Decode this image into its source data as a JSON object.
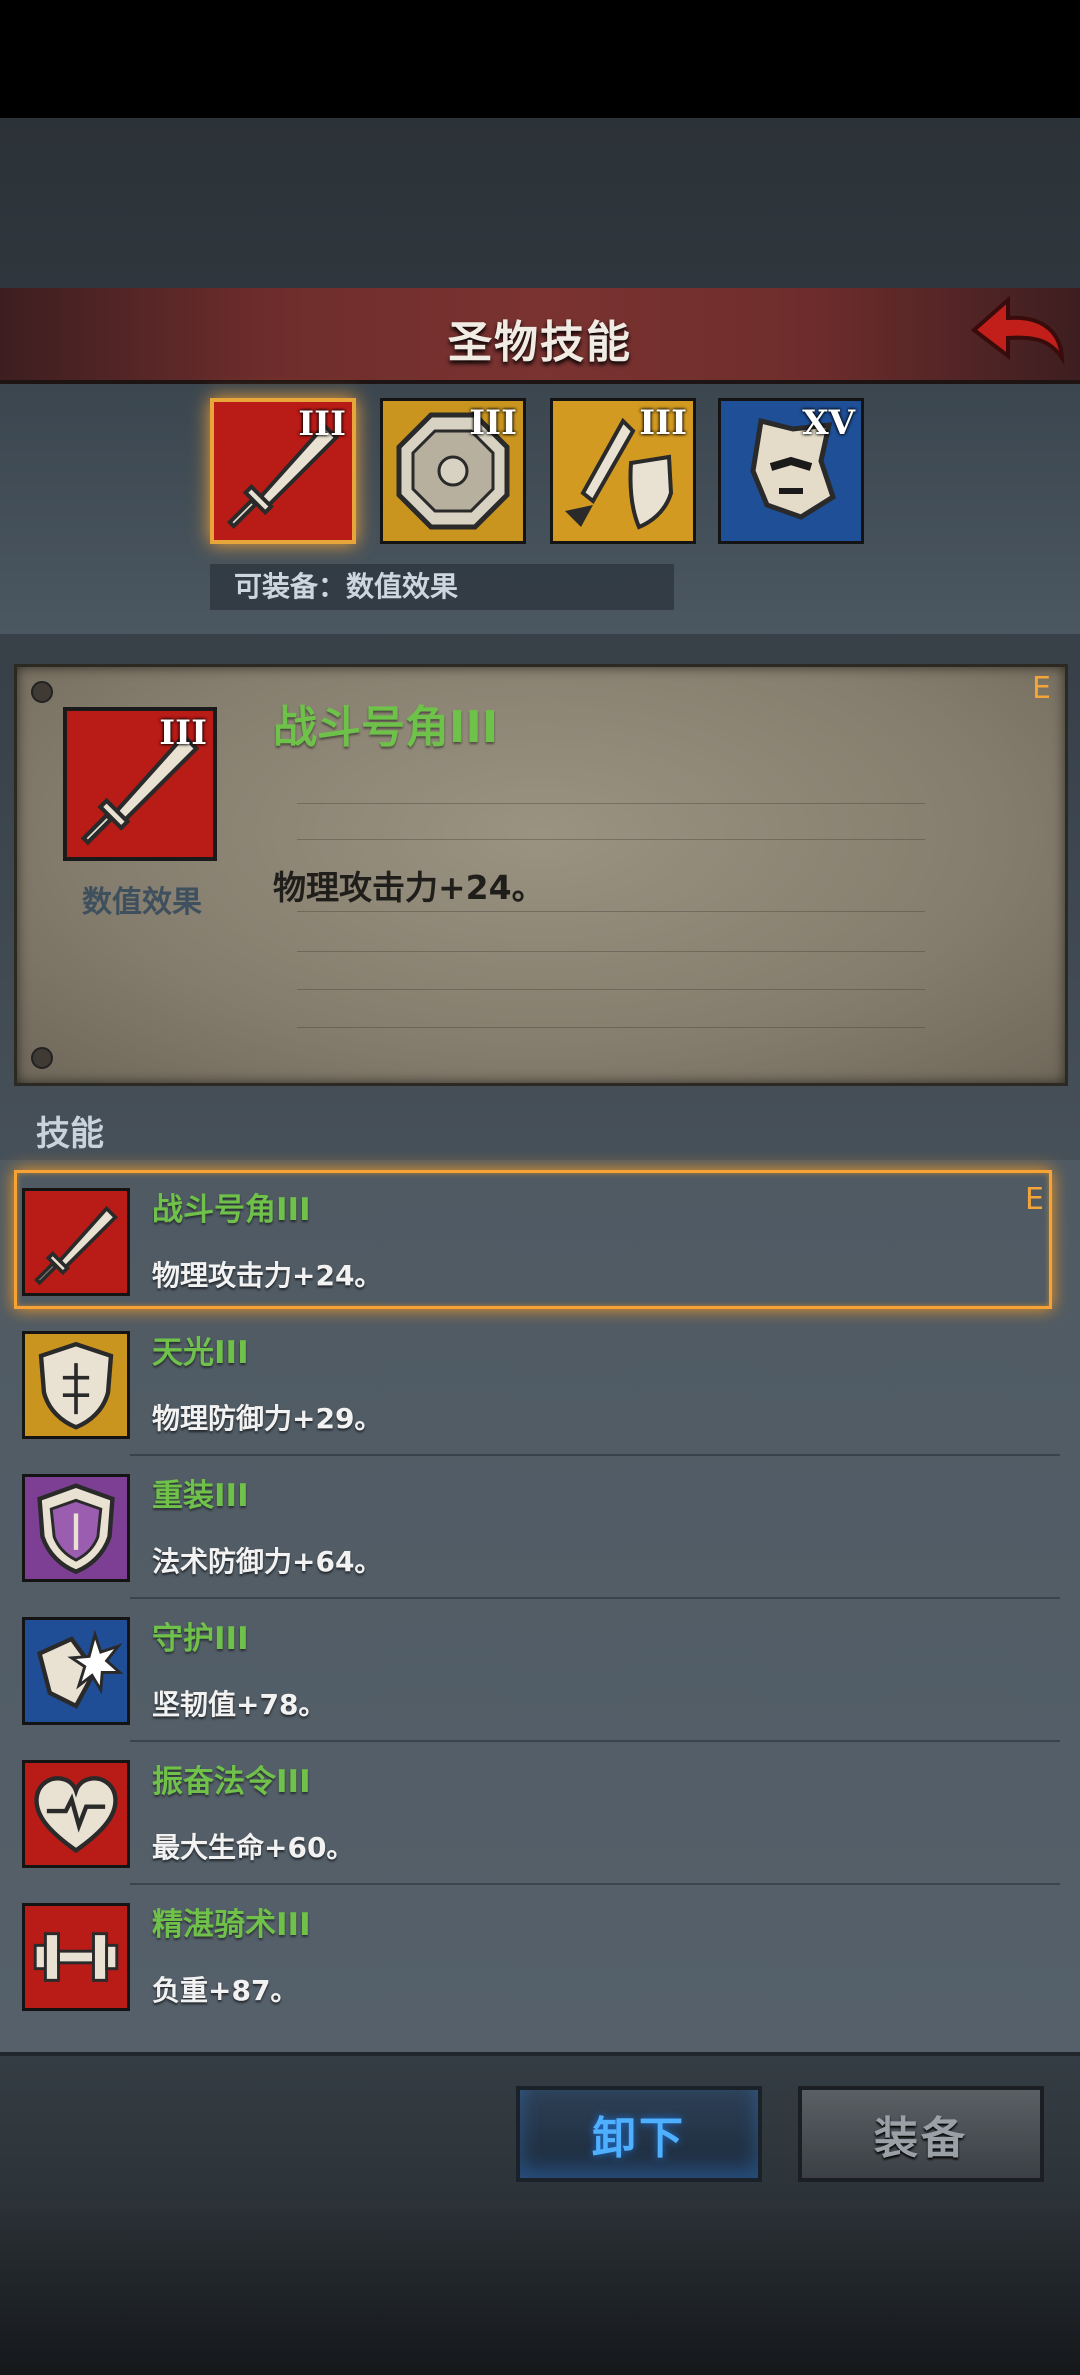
{
  "header": {
    "title": "圣物技能"
  },
  "relics": [
    {
      "rank": "III",
      "icon": "sword-icon",
      "bg": "#b91b17",
      "selected": true
    },
    {
      "rank": "III",
      "icon": "octagon-seal-icon",
      "bg": "#c9951f",
      "selected": false
    },
    {
      "rank": "III",
      "icon": "sword-shield-icon",
      "bg": "#d39a22",
      "selected": false
    },
    {
      "rank": "XV",
      "icon": "mask-icon",
      "bg": "#1e4f97",
      "selected": false
    }
  ],
  "equippable_label": "可装备：数值效果",
  "detail": {
    "rank": "III",
    "icon_label": "数值效果",
    "name": "战斗号角III",
    "desc": "物理攻击力+24。",
    "badge": "E"
  },
  "skills_title": "技能",
  "skills": [
    {
      "name": "战斗号角III",
      "desc": "物理攻击力+24。",
      "icon": "sword-icon",
      "bg": "#b91b17",
      "badge": "E"
    },
    {
      "name": "天光III",
      "desc": "物理防御力+29。",
      "icon": "shield-icon",
      "bg": "#c9951f"
    },
    {
      "name": "重装III",
      "desc": "法术防御力+64。",
      "icon": "heavy-shield-icon",
      "bg": "#7d3f94"
    },
    {
      "name": "守护III",
      "desc": "坚韧值+78。",
      "icon": "burst-shield-icon",
      "bg": "#1f4e96"
    },
    {
      "name": "振奋法令III",
      "desc": "最大生命+60。",
      "icon": "heart-icon",
      "bg": "#b91b17"
    },
    {
      "name": "精湛骑术III",
      "desc": "负重+87。",
      "icon": "dumbbell-icon",
      "bg": "#b91b17"
    }
  ],
  "buttons": {
    "unequip": "卸下",
    "equip": "装备"
  }
}
